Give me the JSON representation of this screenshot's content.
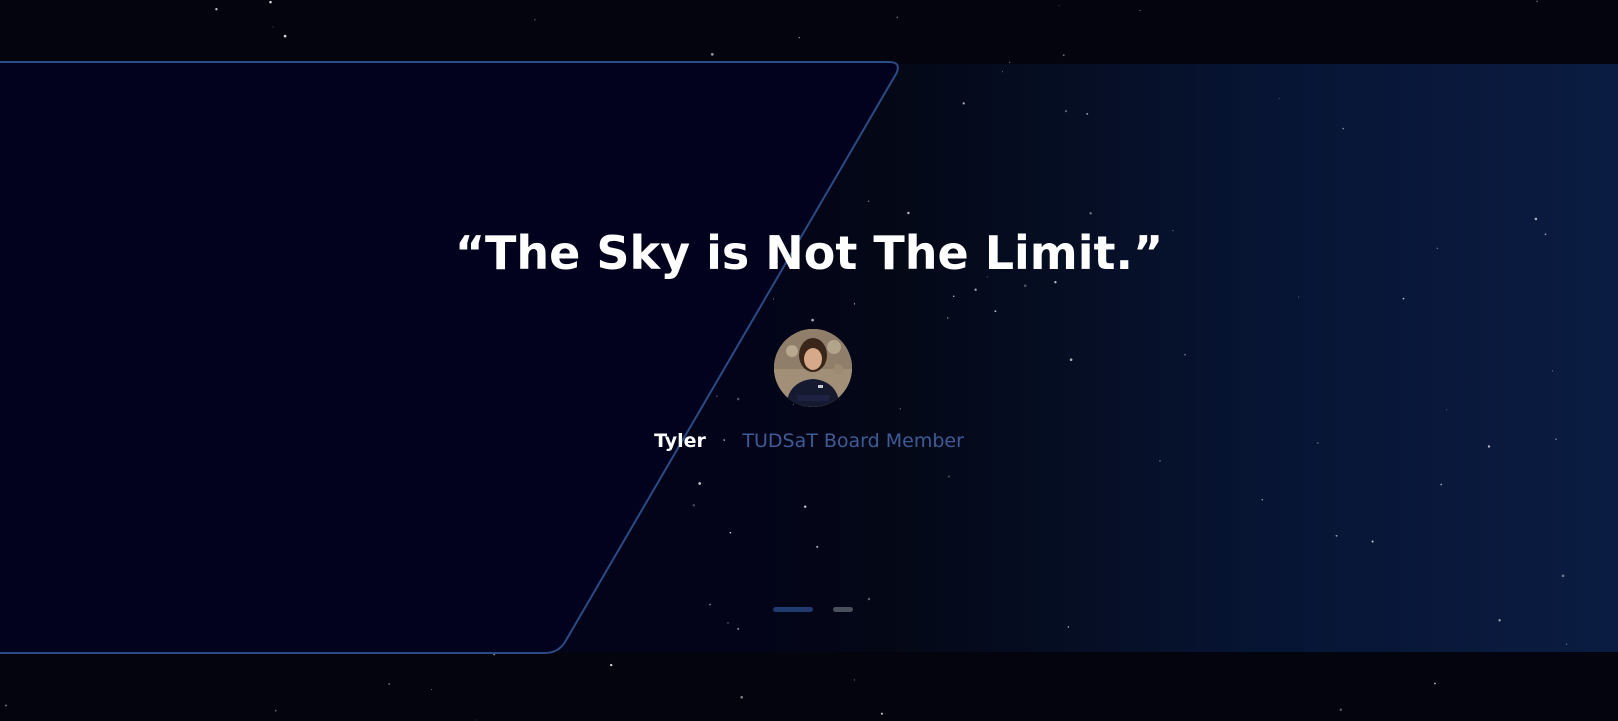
{
  "testimonial": {
    "quote": "“The Sky is Not The Limit.”",
    "author_name": "Tyler",
    "separator": "·",
    "author_role": "TUDSaT Board Member",
    "avatar_icon": "person-photo"
  },
  "carousel": {
    "slide_count": 2,
    "active_index": 0
  },
  "colors": {
    "background": "#04040f",
    "panel_border": "#2a4b86",
    "quote_text": "#ffffff",
    "role_text": "#3e5b96",
    "dot_active": "#1f3a6e",
    "dot_inactive": "#4a4f5c"
  }
}
